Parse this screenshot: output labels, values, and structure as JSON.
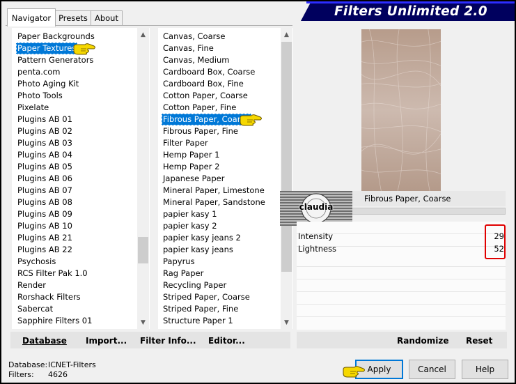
{
  "window": {
    "title": "Filters Unlimited 2.0"
  },
  "tabs": [
    {
      "label": "Navigator",
      "active": true
    },
    {
      "label": "Presets",
      "active": false
    },
    {
      "label": "About",
      "active": false
    }
  ],
  "categories": {
    "items": [
      "Paper Backgrounds",
      "Paper Textures",
      "Pattern Generators",
      "penta.com",
      "Photo Aging Kit",
      "Photo Tools",
      "Pixelate",
      "Plugins AB 01",
      "Plugins AB 02",
      "Plugins AB 03",
      "Plugins AB 04",
      "Plugins AB 05",
      "Plugins AB 06",
      "Plugins AB 07",
      "Plugins AB 08",
      "Plugins AB 09",
      "Plugins AB 10",
      "Plugins AB 21",
      "Plugins AB 22",
      "Psychosis",
      "RCS Filter Pak 1.0",
      "Render",
      "Rorshack Filters",
      "Sabercat",
      "Sapphire Filters 01"
    ],
    "selected": "Paper Textures"
  },
  "filters": {
    "items": [
      "Canvas, Coarse",
      "Canvas, Fine",
      "Canvas, Medium",
      "Cardboard Box, Coarse",
      "Cardboard Box, Fine",
      "Cotton Paper, Coarse",
      "Cotton Paper, Fine",
      "Fibrous Paper, Coarse",
      "Fibrous Paper, Fine",
      "Filter Paper",
      "Hemp Paper 1",
      "Hemp Paper 2",
      "Japanese Paper",
      "Mineral Paper, Limestone",
      "Mineral Paper, Sandstone",
      "papier kasy 1",
      "papier kasy 2",
      "papier kasy jeans 2",
      "papier kasy jeans",
      "Papyrus",
      "Rag Paper",
      "Recycling Paper",
      "Striped Paper, Coarse",
      "Striped Paper, Fine",
      "Structure Paper 1"
    ],
    "selected": "Fibrous Paper, Coarse"
  },
  "preview": {
    "filter_name": "Fibrous Paper, Coarse",
    "watermark": "claudia"
  },
  "params": [
    {
      "label": "Intensity",
      "value": "29"
    },
    {
      "label": "Lightness",
      "value": "52"
    }
  ],
  "toolbar": {
    "database": "Database",
    "import": "Import...",
    "filter_info": "Filter Info...",
    "editor": "Editor...",
    "randomize": "Randomize",
    "reset": "Reset"
  },
  "status": {
    "database_label": "Database:",
    "database_value": "ICNET-Filters",
    "filters_label": "Filters:",
    "filters_value": "4626"
  },
  "buttons": {
    "apply": "Apply",
    "cancel": "Cancel",
    "help": "Help"
  },
  "colors": {
    "banner": "#00005e",
    "selection": "#0078d7",
    "highlight_box": "#e00000",
    "hand": "#f6d800"
  }
}
